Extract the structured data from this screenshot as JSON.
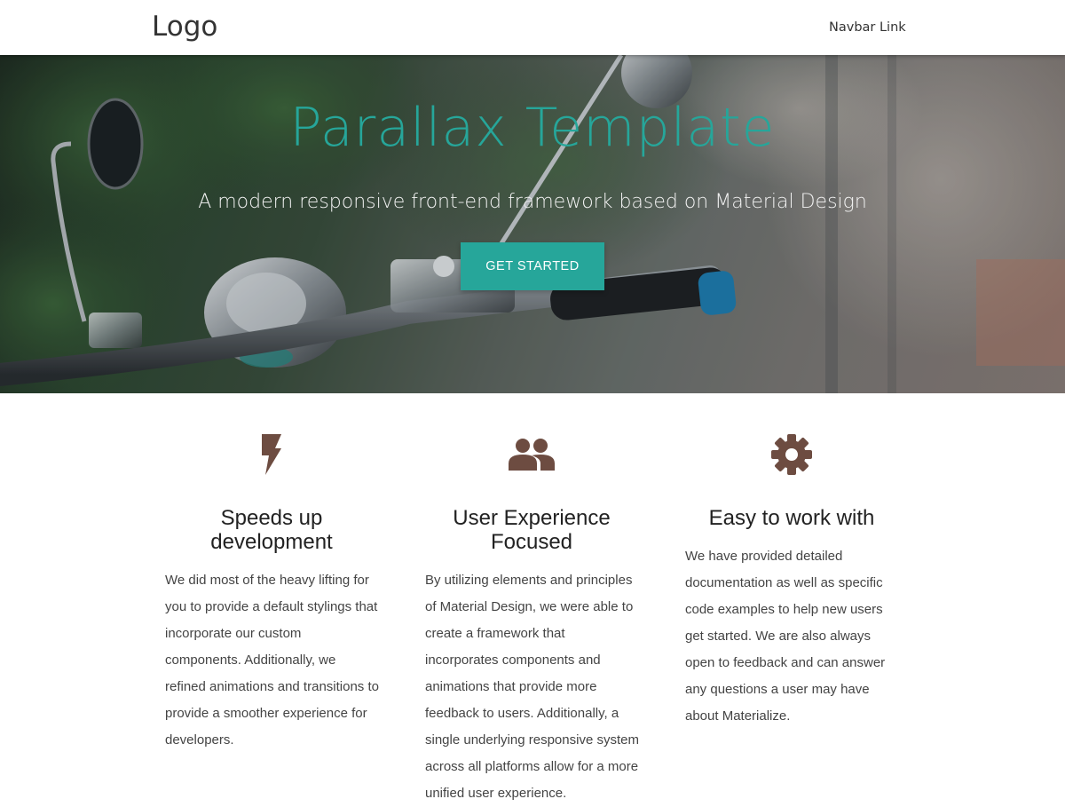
{
  "navbar": {
    "logo": "Logo",
    "link": "Navbar Link"
  },
  "hero": {
    "title": "Parallax Template",
    "subtitle": "A modern responsive front-end framework based on Material Design",
    "button_label": "GET STARTED"
  },
  "colors": {
    "accent": "#26a69a",
    "icon": "#6d4c41"
  },
  "features": [
    {
      "icon": "flash-icon",
      "title": "Speeds up development",
      "text": "We did most of the heavy lifting for you to provide a default stylings that incorporate our custom components. Additionally, we refined animations and transitions to provide a smoother experience for developers."
    },
    {
      "icon": "group-icon",
      "title": "User Experience Focused",
      "text": "By utilizing elements and principles of Material Design, we were able to create a framework that incorporates components and animations that provide more feedback to users. Additionally, a single underlying responsive system across all platforms allow for a more unified user experience."
    },
    {
      "icon": "settings-icon",
      "title": "Easy to work with",
      "text": "We have provided detailed documentation as well as specific code examples to help new users get started. We are also always open to feedback and can answer any questions a user may have about Materialize."
    }
  ]
}
